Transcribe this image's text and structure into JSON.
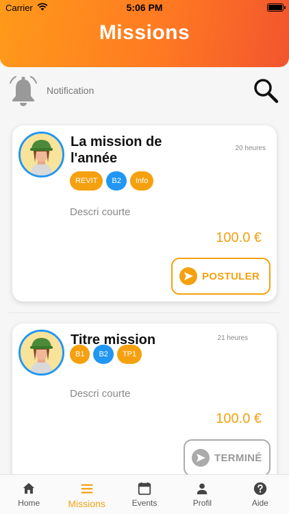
{
  "status_bar": {
    "carrier": "Carrier",
    "time": "5:06 PM"
  },
  "header": {
    "title": "Missions"
  },
  "notification": {
    "label": "Notification"
  },
  "missions": [
    {
      "title": "La mission de l'année",
      "time": "20 heures",
      "tags": [
        {
          "label": "REVIT",
          "color": "#f5a00f"
        },
        {
          "label": "B2",
          "color": "#2196f3"
        },
        {
          "label": "Info",
          "color": "#f5a00f"
        }
      ],
      "description": "Descri courte",
      "price": "100.0 €",
      "action": "POSTULER"
    },
    {
      "title": "Titre mission",
      "time": "21 heures",
      "tags": [
        {
          "label": "B1",
          "color": "#f5a00f"
        },
        {
          "label": "B2",
          "color": "#2196f3"
        },
        {
          "label": "TP1",
          "color": "#f5a00f"
        }
      ],
      "description": "Descri courte",
      "price": "100.0 €",
      "action": "TERMINÉ"
    }
  ],
  "tabbar": {
    "items": [
      {
        "label": "Home",
        "icon": "home-icon"
      },
      {
        "label": "Missions",
        "icon": "menu-icon",
        "active": true
      },
      {
        "label": "Events",
        "icon": "calendar-icon"
      },
      {
        "label": "Profil",
        "icon": "person-icon"
      },
      {
        "label": "Aide",
        "icon": "help-icon"
      }
    ]
  },
  "colors": {
    "accent": "#f5a00f",
    "blue": "#2196f3",
    "header_start": "#ff9a1a",
    "header_end": "#f2552e"
  }
}
